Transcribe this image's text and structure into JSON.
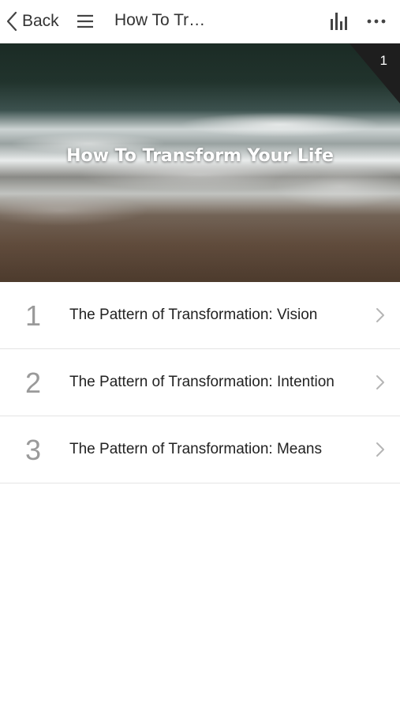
{
  "nav": {
    "back_label": "Back",
    "title": "How To Tr…",
    "icons": {
      "back": "chevron-left-icon",
      "menu": "hamburger-menu-icon",
      "stats": "bar-chart-icon",
      "more": "more-dots-icon"
    }
  },
  "hero": {
    "title": "How To Transform Your Life",
    "corner_number": "1"
  },
  "lessons": [
    {
      "number": "1",
      "title": "The Pattern of Transformation: Vision"
    },
    {
      "number": "2",
      "title": "The Pattern of Transformation: Intention"
    },
    {
      "number": "3",
      "title": "The Pattern of Transformation: Means"
    }
  ],
  "colors": {
    "text": "#222222",
    "muted": "#9a9a9a",
    "divider": "#e4e4e4",
    "icon": "#444444"
  }
}
